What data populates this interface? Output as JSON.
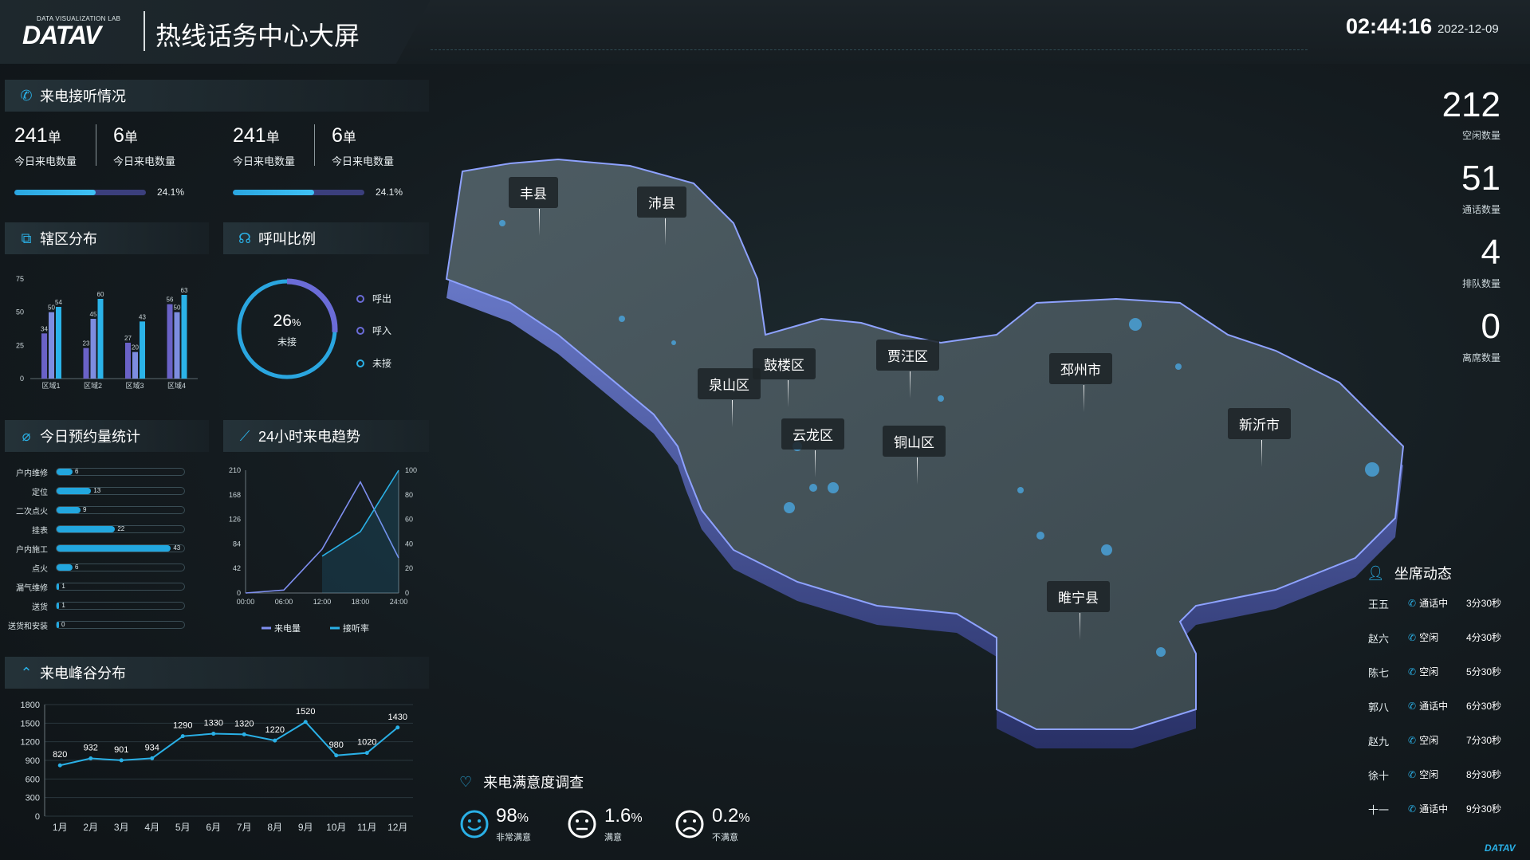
{
  "header": {
    "logo_small": "DATA VISUALIZATION LAB",
    "logo": "DATAV",
    "title": "热线话务中心大屏",
    "time": "02:44:16",
    "date": "2022-12-09"
  },
  "calls": {
    "title": "来电接听情况",
    "groups": [
      {
        "a_num": "241",
        "a_unit": "单",
        "a_label": "今日来电数量",
        "b_num": "6",
        "b_unit": "单",
        "b_label": "今日来电数量",
        "progress": 0.241,
        "pct": "24.1%"
      },
      {
        "a_num": "241",
        "a_unit": "单",
        "a_label": "今日来电数量",
        "b_num": "6",
        "b_unit": "单",
        "b_label": "今日来电数量",
        "progress": 0.241,
        "pct": "24.1%"
      }
    ]
  },
  "district": {
    "title": "辖区分布",
    "chart_data": {
      "type": "bar",
      "categories": [
        "区域1",
        "区域2",
        "区域3",
        "区域4"
      ],
      "series": [
        {
          "values": [
            34,
            23,
            27,
            56
          ]
        },
        {
          "values": [
            50,
            45,
            20,
            50
          ]
        },
        {
          "values": [
            54,
            60,
            43,
            63
          ]
        }
      ],
      "ylim": [
        0,
        75
      ],
      "yticks": [
        "75",
        "50",
        "25",
        "0"
      ],
      "colors": [
        "#6a62c7",
        "#7d8de0",
        "#2bb3e8"
      ]
    }
  },
  "call_ratio": {
    "title": "呼叫比例",
    "value": "26",
    "unit": "%",
    "label": "未接",
    "fraction": 0.26,
    "legend": [
      "呼出",
      "呼入",
      "未接"
    ]
  },
  "appointments": {
    "title": "今日预约量统计",
    "items": [
      {
        "label": "户内维修",
        "value": "6",
        "n": 6
      },
      {
        "label": "定位",
        "value": "13",
        "n": 13
      },
      {
        "label": "二次点火",
        "value": "9",
        "n": 9
      },
      {
        "label": "挂表",
        "value": "22",
        "n": 22
      },
      {
        "label": "户内施工",
        "value": "43",
        "n": 43
      },
      {
        "label": "点火",
        "value": "6",
        "n": 6
      },
      {
        "label": "漏气维修",
        "value": "1",
        "n": 1
      },
      {
        "label": "送货",
        "value": "1",
        "n": 1
      },
      {
        "label": "送货和安装",
        "value": "0",
        "n": 0
      }
    ],
    "max": 48
  },
  "trend": {
    "title": "24小时来电趋势",
    "chart_data": {
      "type": "line",
      "x": [
        "00:00",
        "06:00",
        "12:00",
        "18:00",
        "24:00"
      ],
      "series": [
        {
          "name": "来电量",
          "axis": "left",
          "x": [
            0,
            6,
            12,
            18,
            24
          ],
          "values": [
            0,
            5,
            75,
            190,
            60
          ]
        },
        {
          "name": "接听率",
          "axis": "right",
          "x": [
            12,
            18,
            24
          ],
          "values": [
            30,
            50,
            100
          ]
        }
      ],
      "y_left": [
        "210",
        "168",
        "126",
        "84",
        "42",
        "0"
      ],
      "y_right": [
        "100",
        "80",
        "60",
        "40",
        "20",
        "0"
      ],
      "ylim_left": [
        0,
        210
      ],
      "ylim_right": [
        0,
        100
      ]
    }
  },
  "peak": {
    "title": "来电峰谷分布",
    "chart_data": {
      "type": "line",
      "categories": [
        "1月",
        "2月",
        "3月",
        "4月",
        "5月",
        "6月",
        "7月",
        "8月",
        "9月",
        "10月",
        "11月",
        "12月"
      ],
      "values": [
        820,
        932,
        901,
        934,
        1290,
        1330,
        1320,
        1220,
        1520,
        980,
        1020,
        1430
      ],
      "labels": [
        "820",
        "932",
        "901",
        "934",
        "1290",
        "1330",
        "1320",
        "1220",
        "1520",
        "980",
        "1020",
        "1430"
      ],
      "yticks": [
        "1800",
        "1500",
        "1200",
        "900",
        "600",
        "300",
        "0"
      ],
      "ylim": [
        0,
        1800
      ]
    }
  },
  "right_stats": [
    {
      "num": "212",
      "label": "空闲数量"
    },
    {
      "num": "51",
      "label": "通话数量"
    },
    {
      "num": "4",
      "label": "排队数量"
    },
    {
      "num": "0",
      "label": "离席数量"
    }
  ],
  "seats": {
    "title": "坐席动态",
    "rows": [
      {
        "name": "王五",
        "status": "通话中",
        "time": "3分30秒"
      },
      {
        "name": "赵六",
        "status": "空闲",
        "time": "4分30秒"
      },
      {
        "name": "陈七",
        "status": "空闲",
        "time": "5分30秒"
      },
      {
        "name": "郭八",
        "status": "通话中",
        "time": "6分30秒"
      },
      {
        "name": "赵九",
        "status": "空闲",
        "time": "7分30秒"
      },
      {
        "name": "徐十",
        "status": "空闲",
        "time": "8分30秒"
      },
      {
        "name": "十一",
        "status": "通话中",
        "time": "9分30秒"
      }
    ]
  },
  "map": {
    "labels": [
      "丰县",
      "沛县",
      "鼓楼区",
      "贾汪区",
      "泉山区",
      "邳州市",
      "云龙区",
      "铜山区",
      "新沂市",
      "睢宁县"
    ]
  },
  "satisfaction": {
    "title": "来电满意度调查",
    "items": [
      {
        "num": "98",
        "unit": "%",
        "label": "非常满意"
      },
      {
        "num": "1.6",
        "unit": "%",
        "label": "满意"
      },
      {
        "num": "0.2",
        "unit": "%",
        "label": "不满意"
      }
    ]
  },
  "footer_logo": "DATAV"
}
